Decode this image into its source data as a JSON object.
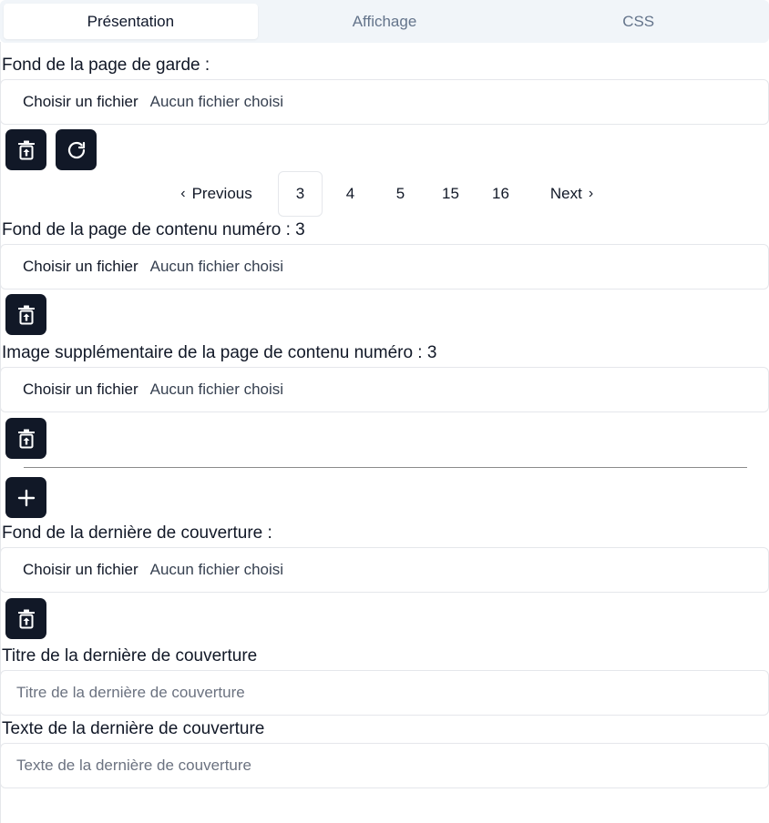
{
  "tabs": [
    {
      "label": "Présentation",
      "active": true
    },
    {
      "label": "Affichage",
      "active": false
    },
    {
      "label": "CSS",
      "active": false
    }
  ],
  "cover": {
    "label": "Fond de la page de garde :",
    "file_button": "Choisir un fichier",
    "file_status": "Aucun fichier choisi"
  },
  "pagination": {
    "previous": "Previous",
    "next": "Next",
    "pages": [
      "3",
      "4",
      "5",
      "15",
      "16"
    ],
    "current": "3"
  },
  "content_background": {
    "label": "Fond de la page de contenu numéro : 3",
    "file_button": "Choisir un fichier",
    "file_status": "Aucun fichier choisi"
  },
  "content_extra_image": {
    "label": "Image supplémentaire de la page de contenu numéro : 3",
    "file_button": "Choisir un fichier",
    "file_status": "Aucun fichier choisi"
  },
  "back_cover": {
    "label": "Fond de la dernière de couverture :",
    "file_button": "Choisir un fichier",
    "file_status": "Aucun fichier choisi"
  },
  "back_cover_title": {
    "label": "Titre de la dernière de couverture",
    "placeholder": "Titre de la dernière de couverture",
    "value": ""
  },
  "back_cover_text": {
    "label": "Texte de la dernière de couverture",
    "placeholder": "Texte de la dernière de couverture",
    "value": ""
  },
  "icons": {
    "delete": "trash-icon",
    "reset": "refresh-icon",
    "add": "plus-icon"
  },
  "colors": {
    "button_bg": "#111827",
    "tabs_bg": "#f1f5f9",
    "border": "#e5e7eb"
  }
}
